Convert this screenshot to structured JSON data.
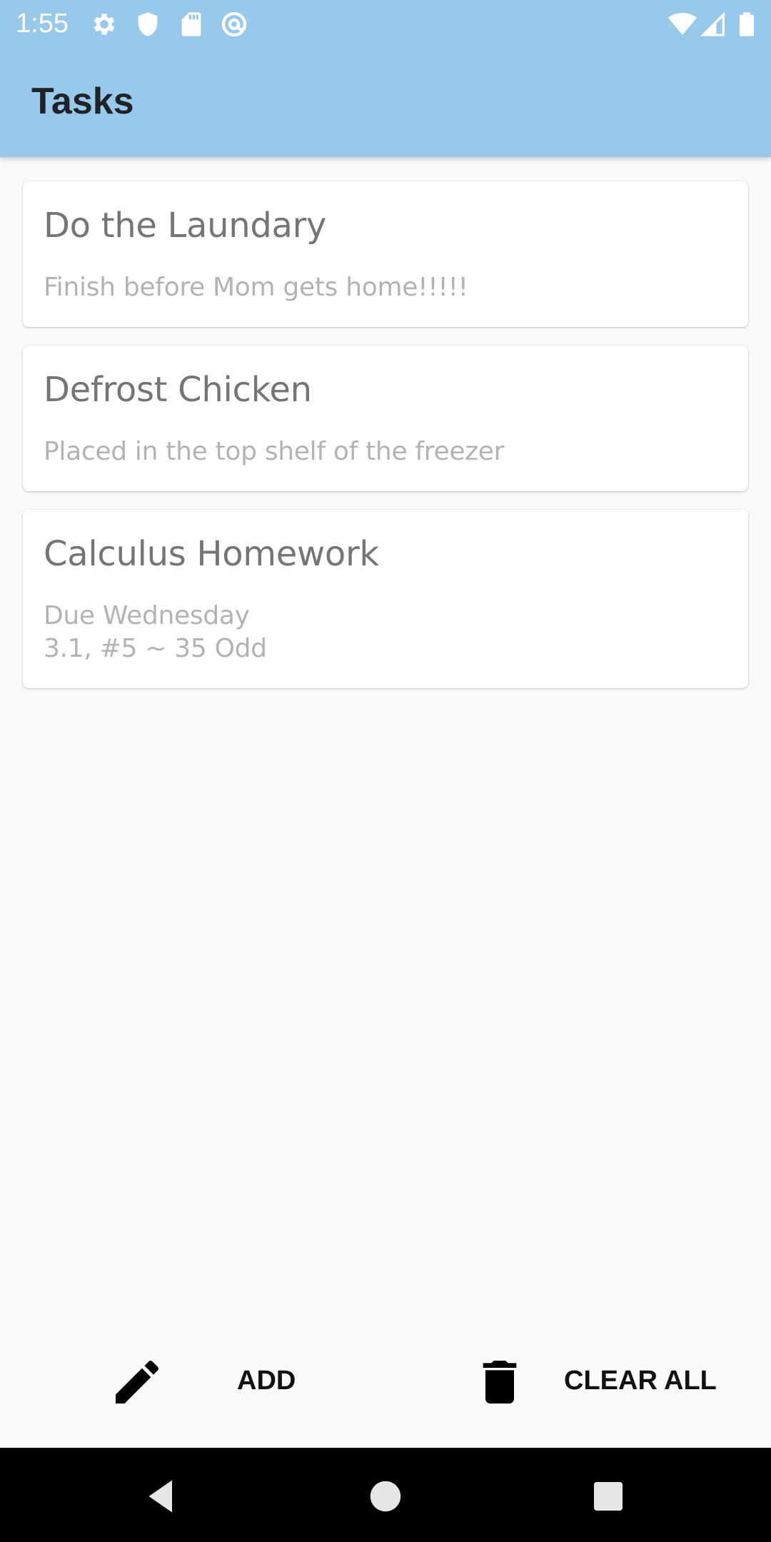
{
  "status_bar": {
    "time": "1:55",
    "left_icons": [
      "gear-icon",
      "shield-icon",
      "sd-card-icon",
      "at-sign-icon"
    ],
    "right_icons": [
      "wifi-icon",
      "cell-signal-icon",
      "battery-icon"
    ]
  },
  "app_bar": {
    "title": "Tasks",
    "background": "#99c9ea"
  },
  "tasks": [
    {
      "title": "Do the Laundary",
      "description": "Finish before Mom gets home!!!!!"
    },
    {
      "title": "Defrost Chicken",
      "description": "Placed in the top shelf of the freezer"
    },
    {
      "title": "Calculus Homework",
      "description": "Due Wednesday\n3.1, #5 ~ 35 Odd"
    }
  ],
  "actions": {
    "add": {
      "label": "ADD",
      "icon": "pencil-icon"
    },
    "clear_all": {
      "label": "CLEAR ALL",
      "icon": "trash-icon"
    }
  },
  "nav_bar": {
    "buttons": [
      "back-icon",
      "home-icon",
      "recents-icon"
    ]
  }
}
